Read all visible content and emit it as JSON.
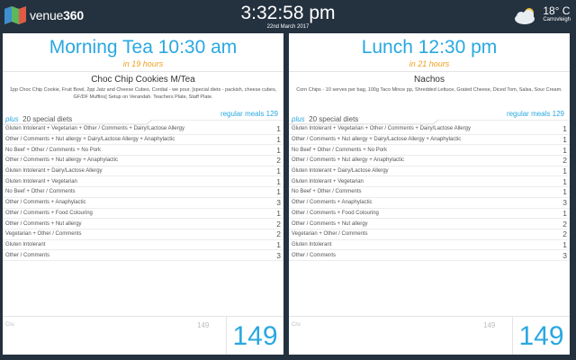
{
  "app": {
    "logo_text": "venue",
    "logo_bold": "360"
  },
  "clock": {
    "time": "3:32:58 pm",
    "date": "22nd March 2017"
  },
  "weather": {
    "temp": "18° C",
    "location": "Carrovleigh",
    "icon": "cloud-sun-icon"
  },
  "colors": {
    "accent": "#29a8e0",
    "eta": "#f0a020",
    "bar": "#24313f"
  },
  "panels": [
    {
      "title": "Morning Tea 10:30 am",
      "eta": "in 19 hours",
      "menu_name": "Choc Chip Cookies M/Tea",
      "menu_desc": "1pp Choc Chip Cookie, Fruit Bowl, 2pp Jatz and Cheese Cubes, Cordial - we pour, [special diets - packish, cheese cubes, GF/DF Muffins] Setup on Verandah. Teachers Plate, Staff Plate.",
      "plus": "plus",
      "special_diets": "20 special diets",
      "regular_label": "regular meals",
      "regular_count": "129",
      "rows": [
        {
          "label": "Gluten Intolerant + Vegetarian + Other / Comments + Dairy/Lactose Allergy",
          "count": "1"
        },
        {
          "label": "Other / Comments + Nut allergy + Dairy/Lactose Allergy + Anaphylactic",
          "count": "1"
        },
        {
          "label": "No Beef + Other / Comments + No Pork",
          "count": "1"
        },
        {
          "label": "Other / Comments + Nut allergy + Anaphylactic",
          "count": "2"
        },
        {
          "label": "Gluten Intolerant + Dairy/Lactose Allergy",
          "count": "1"
        },
        {
          "label": "Gluten Intolerant + Vegetarian",
          "count": "1"
        },
        {
          "label": "No Beef + Other / Comments",
          "count": "1"
        },
        {
          "label": "Other / Comments + Anaphylactic",
          "count": "3"
        },
        {
          "label": "Other / Comments + Food Colouring",
          "count": "1"
        },
        {
          "label": "Other / Comments + Nut allergy",
          "count": "2"
        },
        {
          "label": "Vegetarian + Other / Comments",
          "count": "2"
        },
        {
          "label": "Gluten Intolerant",
          "count": "1"
        },
        {
          "label": "Other / Comments",
          "count": "3"
        }
      ],
      "footer_label": "Cru",
      "footer_count": "149",
      "total": "149"
    },
    {
      "title": "Lunch 12:30 pm",
      "eta": "in 21 hours",
      "menu_name": "Nachos",
      "menu_desc": "Corn Chips - 10 serves per bag, 100g Taco Mince pp, Shredded Lettuce, Grated Cheese, Diced Tom, Salsa, Sour Cream.",
      "plus": "plus",
      "special_diets": "20 special diets",
      "regular_label": "regular meals",
      "regular_count": "129",
      "rows": [
        {
          "label": "Gluten Intolerant + Vegetarian + Other / Comments + Dairy/Lactose Allergy",
          "count": "1"
        },
        {
          "label": "Other / Comments + Nut allergy + Dairy/Lactose Allergy + Anaphylactic",
          "count": "1"
        },
        {
          "label": "No Beef + Other / Comments + No Pork",
          "count": "1"
        },
        {
          "label": "Other / Comments + Nut allergy + Anaphylactic",
          "count": "2"
        },
        {
          "label": "Gluten Intolerant + Dairy/Lactose Allergy",
          "count": "1"
        },
        {
          "label": "Gluten Intolerant + Vegetarian",
          "count": "1"
        },
        {
          "label": "No Beef + Other / Comments",
          "count": "1"
        },
        {
          "label": "Other / Comments + Anaphylactic",
          "count": "3"
        },
        {
          "label": "Other / Comments + Food Colouring",
          "count": "1"
        },
        {
          "label": "Other / Comments + Nut allergy",
          "count": "2"
        },
        {
          "label": "Vegetarian + Other / Comments",
          "count": "2"
        },
        {
          "label": "Gluten Intolerant",
          "count": "1"
        },
        {
          "label": "Other / Comments",
          "count": "3"
        }
      ],
      "footer_label": "Cru",
      "footer_count": "149",
      "total": "149"
    }
  ]
}
